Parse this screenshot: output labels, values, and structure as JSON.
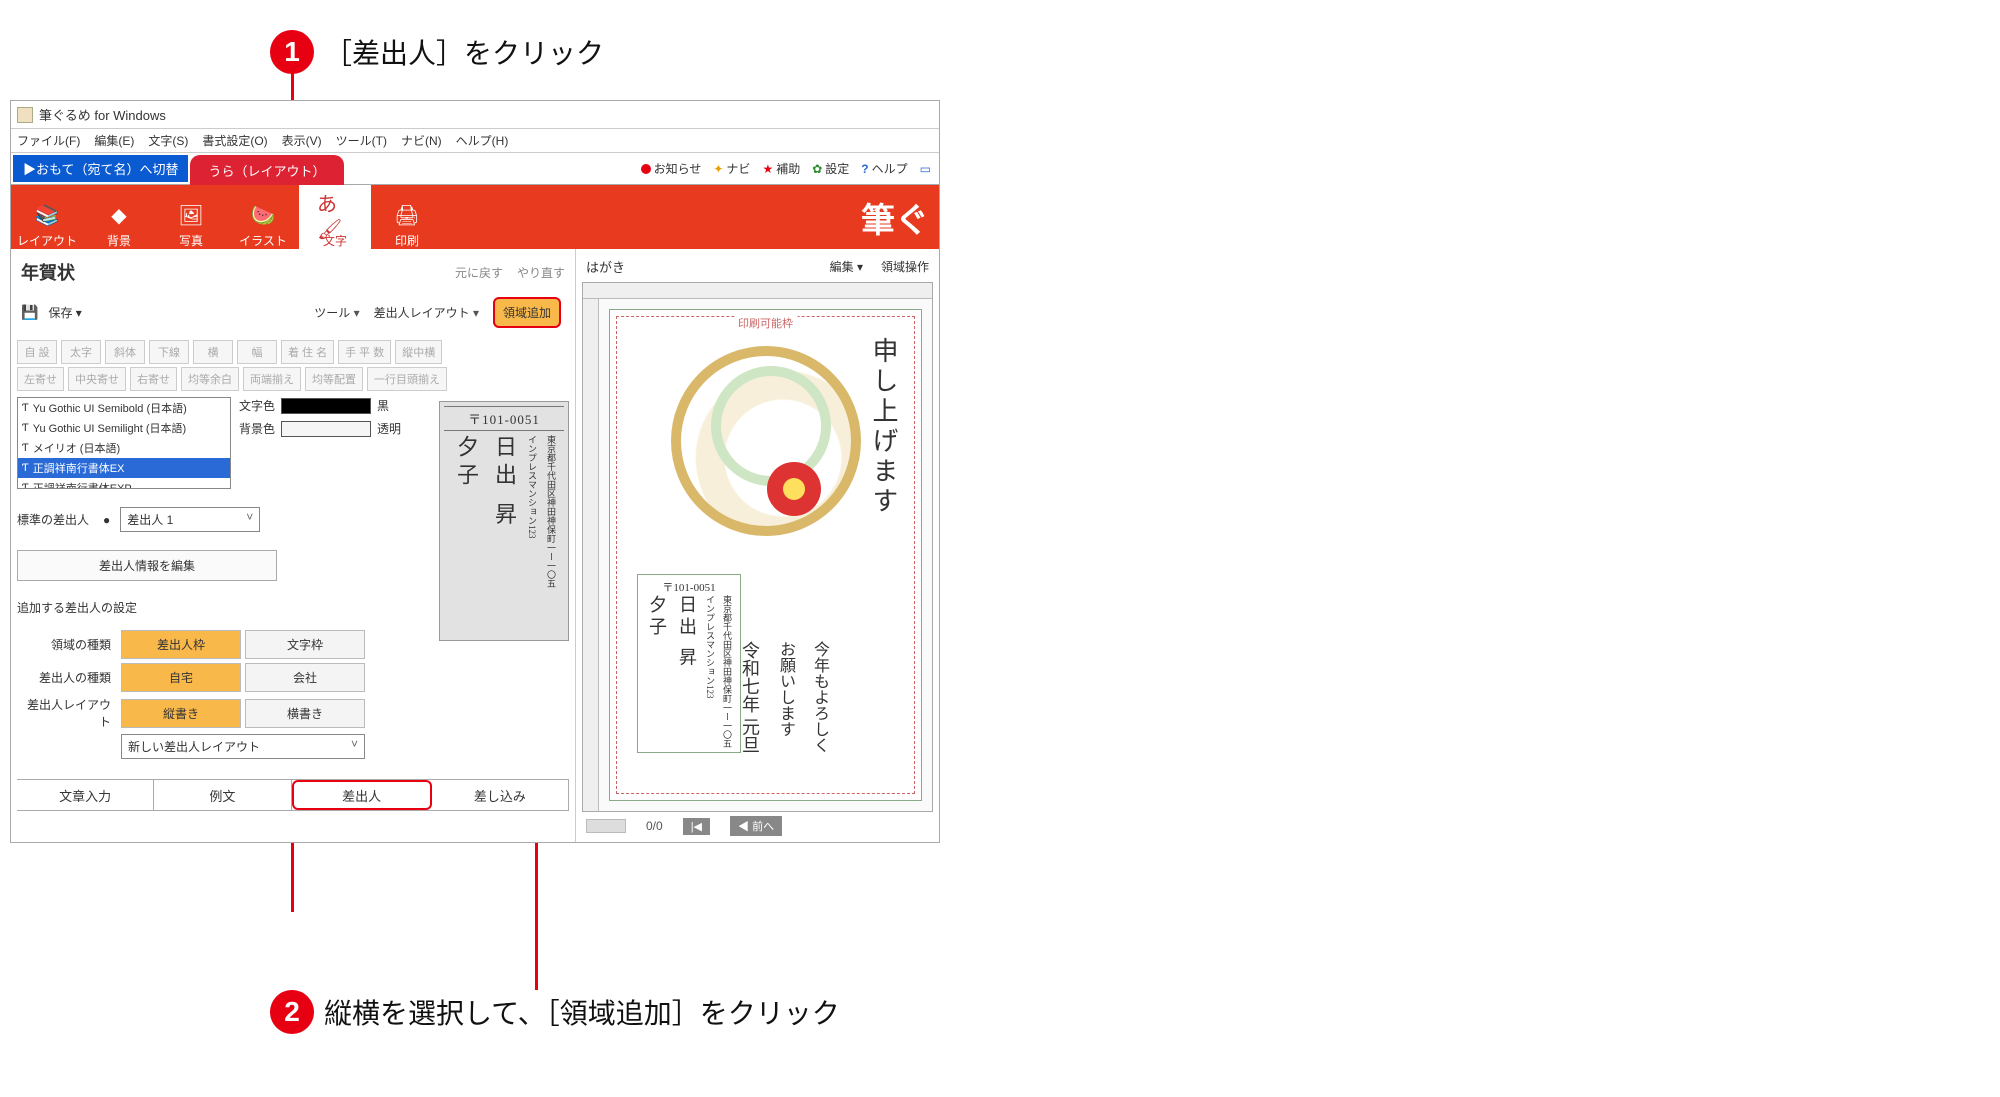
{
  "callout1": "［差出人］をクリック",
  "callout2": "縦横を選択して、［領域追加］をクリック",
  "num1": "1",
  "num2": "2",
  "window_title": "筆ぐるめ for Windows",
  "menus": {
    "file": "ファイル(F)",
    "edit": "編集(E)",
    "text": "文字(S)",
    "format": "書式設定(O)",
    "view": "表示(V)",
    "tool": "ツール(T)",
    "navi": "ナビ(N)",
    "help": "ヘルプ(H)"
  },
  "tabs": {
    "omote": "▶おもて（宛て名）へ切替",
    "ura": "うら（レイアウト）"
  },
  "toplinks": {
    "news": "お知らせ",
    "navi": "ナビ",
    "hojo": "補助",
    "settings": "設定",
    "help": "ヘルプ"
  },
  "ribbon": {
    "layout": "レイアウト",
    "bg": "背景",
    "photo": "写真",
    "illust": "イラスト",
    "moji": "文字",
    "print": "印刷",
    "logo": "筆ぐ"
  },
  "left": {
    "title": "年賀状",
    "undo": "元に戻す",
    "redo": "やり直す",
    "save": "保存",
    "tool": "ツール",
    "sender_layout": "差出人レイアウト",
    "add_region": "領域追加",
    "dt1": [
      "自 設",
      "太字",
      "斜体",
      "下線",
      "横",
      "幅",
      "着 住 名",
      "手 平 数",
      "縦中横"
    ],
    "dt2": [
      "左寄せ",
      "中央寄せ",
      "右寄せ",
      "均等余白",
      "両端揃え",
      "均等配置",
      "一行目頭揃え"
    ],
    "fonts": [
      "Yu Gothic UI Semibold (日本語)",
      "Yu Gothic UI Semilight (日本語)",
      "メイリオ (日本語)",
      "正調祥南行書体EX",
      "正調祥南行書体EXP"
    ],
    "font_sel_idx": 3,
    "textcolor_lbl": "文字色",
    "textcolor_val": "黒",
    "bgcolor_lbl": "背景色",
    "bgcolor_val": "透明",
    "std_sender_lbl": "標準の差出人",
    "std_sender_val": "差出人 1",
    "edit_sender_btn": "差出人情報を編集",
    "add_sender_lbl": "追加する差出人の設定",
    "opt_area": "領域の種類",
    "opt_area_a": "差出人枠",
    "opt_area_b": "文字枠",
    "opt_type": "差出人の種類",
    "opt_type_a": "自宅",
    "opt_type_b": "会社",
    "opt_layout": "差出人レイアウト",
    "opt_layout_a": "縦書き",
    "opt_layout_b": "横書き",
    "new_layout": "新しい差出人レイアウト",
    "bottom_tabs": {
      "a": "文章入力",
      "b": "例文",
      "c": "差出人",
      "d": "差し込み"
    },
    "sample": {
      "zip": "〒101-0051",
      "addr": "東京都千代田区神田神保町一ー一〇五",
      "bldg": "インプレスマンション123",
      "name1": "日出 昇",
      "name2": "夕子"
    }
  },
  "right": {
    "hagaki": "はがき",
    "edit": "編集",
    "region_ops": "領域操作",
    "print_frame": "印刷可能枠",
    "greeting": "申し上げます",
    "line1": "今年もよろしく",
    "line2": "お願いします",
    "line3": "令和七年 元旦",
    "sender_zip": "〒101-0051",
    "sender_addr": "東京都千代田区神田神保町一ー一〇五",
    "sender_bldg": "インプレスマンション123",
    "sender_name1": "日出 昇",
    "sender_name2": "夕子",
    "pager": "0/0",
    "nav_prev": "◀ 前へ"
  }
}
